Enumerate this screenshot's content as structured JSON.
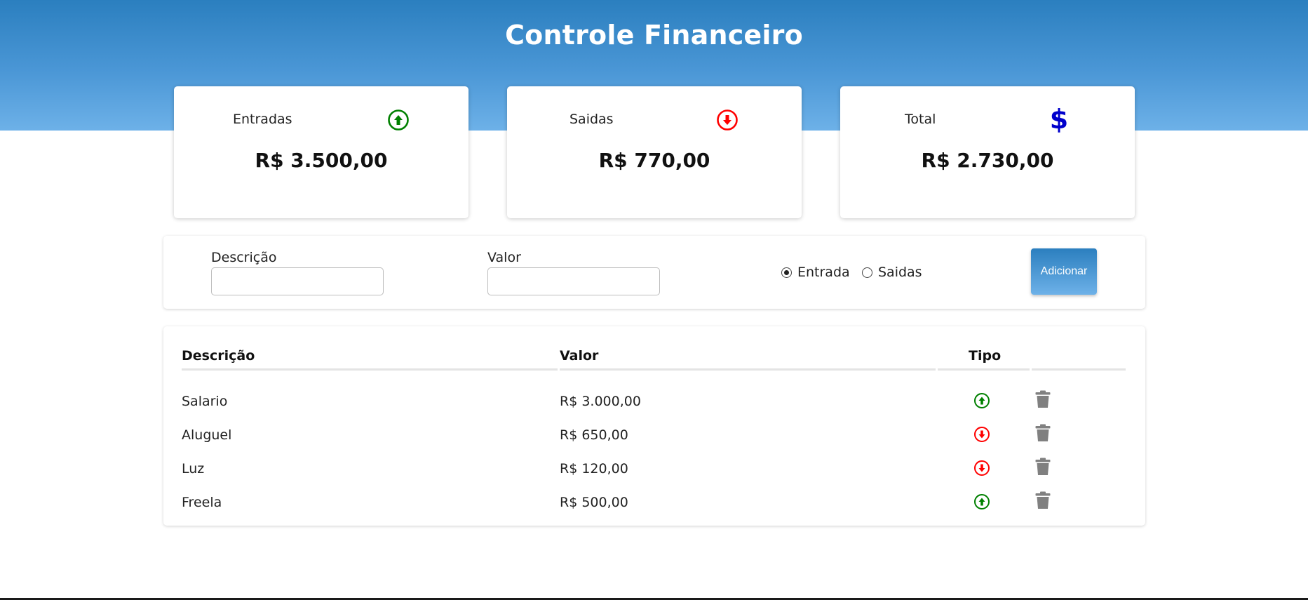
{
  "header": {
    "title": "Controle Financeiro"
  },
  "summary": {
    "entradas": {
      "label": "Entradas",
      "value": "R$ 3.500,00",
      "icon": "arrow-up-circle-icon",
      "color": "#008000"
    },
    "saidas": {
      "label": "Saidas",
      "value": "R$ 770,00",
      "icon": "arrow-down-circle-icon",
      "color": "#ff0000"
    },
    "total": {
      "label": "Total",
      "value": "R$ 2.730,00",
      "icon": "dollar-sign-icon",
      "color": "#0000cc"
    }
  },
  "form": {
    "descricao_label": "Descrição",
    "descricao_value": "",
    "valor_label": "Valor",
    "valor_value": "",
    "radio_entrada_label": "Entrada",
    "radio_saidas_label": "Saidas",
    "selected_type": "Entrada",
    "add_button_label": "Adicionar"
  },
  "table": {
    "headers": [
      "Descrição",
      "Valor",
      "Tipo"
    ],
    "rows": [
      {
        "descricao": "Salario",
        "valor": "R$ 3.000,00",
        "tipo": "entrada"
      },
      {
        "descricao": "Aluguel",
        "valor": "R$ 650,00",
        "tipo": "saida"
      },
      {
        "descricao": "Luz",
        "valor": "R$ 120,00",
        "tipo": "saida"
      },
      {
        "descricao": "Freela",
        "valor": "R$ 500,00",
        "tipo": "entrada"
      }
    ]
  },
  "colors": {
    "accent": "#2b7fbf",
    "entrada": "#008000",
    "saida": "#ff0000",
    "total": "#0000cc",
    "trash": "#808080"
  }
}
